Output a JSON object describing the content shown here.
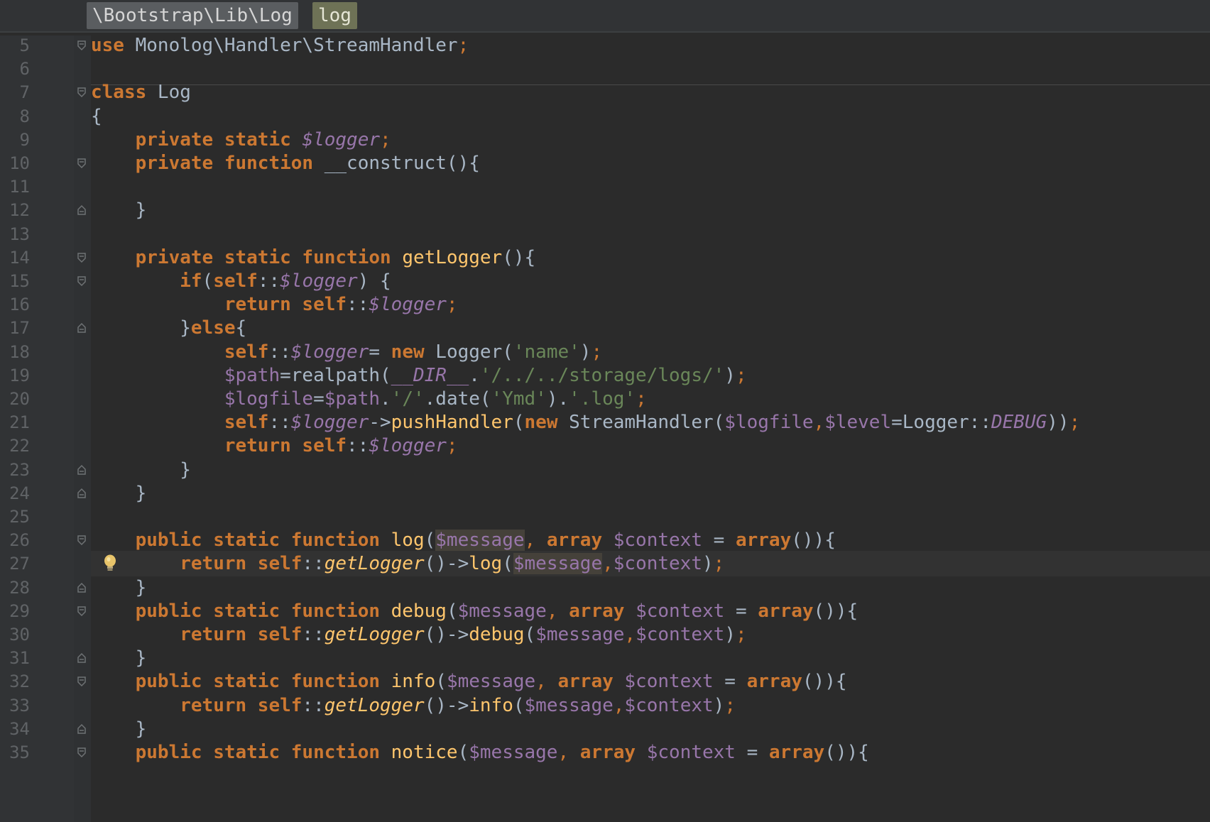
{
  "breadcrumb": {
    "namespace": "\\Bootstrap\\Lib\\Log",
    "class": "log"
  },
  "editor": {
    "current_line": 27,
    "lines": [
      {
        "n": 5,
        "fold": "open",
        "tokens": [
          [
            "kw",
            "use"
          ],
          [
            "plain",
            " Monolog\\Handler\\StreamHandler"
          ],
          [
            "pun",
            ";"
          ]
        ]
      },
      {
        "n": 6,
        "fold": "",
        "tokens": []
      },
      {
        "n": 7,
        "fold": "open",
        "tokens": [
          [
            "kw",
            "class"
          ],
          [
            "plain",
            " Log"
          ]
        ]
      },
      {
        "n": 8,
        "fold": "",
        "tokens": [
          [
            "plain",
            "{"
          ]
        ]
      },
      {
        "n": 9,
        "fold": "",
        "tokens": [
          [
            "plain",
            "    "
          ],
          [
            "kw",
            "private static "
          ],
          [
            "ivar",
            "$logger"
          ],
          [
            "pun",
            ";"
          ]
        ]
      },
      {
        "n": 10,
        "fold": "open",
        "tokens": [
          [
            "plain",
            "    "
          ],
          [
            "kw",
            "private function "
          ],
          [
            "plain",
            "__construct(){"
          ]
        ]
      },
      {
        "n": 11,
        "fold": "",
        "tokens": []
      },
      {
        "n": 12,
        "fold": "close",
        "tokens": [
          [
            "plain",
            "    }"
          ]
        ]
      },
      {
        "n": 13,
        "fold": "",
        "tokens": []
      },
      {
        "n": 14,
        "fold": "open",
        "tokens": [
          [
            "plain",
            "    "
          ],
          [
            "kw",
            "private static function "
          ],
          [
            "fn",
            "getLogger"
          ],
          [
            "plain",
            "(){"
          ]
        ]
      },
      {
        "n": 15,
        "fold": "open",
        "tokens": [
          [
            "plain",
            "        "
          ],
          [
            "kw",
            "if"
          ],
          [
            "plain",
            "("
          ],
          [
            "kw",
            "self"
          ],
          [
            "plain",
            "::"
          ],
          [
            "ivar",
            "$logger"
          ],
          [
            "plain",
            ") {"
          ]
        ]
      },
      {
        "n": 16,
        "fold": "",
        "tokens": [
          [
            "plain",
            "            "
          ],
          [
            "kw",
            "return self"
          ],
          [
            "plain",
            "::"
          ],
          [
            "ivar",
            "$logger"
          ],
          [
            "pun",
            ";"
          ]
        ]
      },
      {
        "n": 17,
        "fold": "close",
        "tokens": [
          [
            "plain",
            "        }"
          ],
          [
            "kw",
            "else"
          ],
          [
            "plain",
            "{"
          ]
        ]
      },
      {
        "n": 18,
        "fold": "",
        "tokens": [
          [
            "plain",
            "            "
          ],
          [
            "kw",
            "self"
          ],
          [
            "plain",
            "::"
          ],
          [
            "ivar",
            "$logger"
          ],
          [
            "plain",
            "= "
          ],
          [
            "kw",
            "new "
          ],
          [
            "plain",
            "Logger("
          ],
          [
            "str",
            "'name'"
          ],
          [
            "plain",
            ")"
          ],
          [
            "pun",
            ";"
          ]
        ]
      },
      {
        "n": 19,
        "fold": "",
        "tokens": [
          [
            "plain",
            "            "
          ],
          [
            "var",
            "$path"
          ],
          [
            "plain",
            "=realpath("
          ],
          [
            "ivar",
            "__DIR__"
          ],
          [
            "plain",
            "."
          ],
          [
            "str",
            "'/../../storage/logs/'"
          ],
          [
            "plain",
            ")"
          ],
          [
            "pun",
            ";"
          ]
        ]
      },
      {
        "n": 20,
        "fold": "",
        "tokens": [
          [
            "plain",
            "            "
          ],
          [
            "var",
            "$logfile"
          ],
          [
            "plain",
            "="
          ],
          [
            "var",
            "$path"
          ],
          [
            "plain",
            "."
          ],
          [
            "str",
            "'/'"
          ],
          [
            "plain",
            ".date("
          ],
          [
            "str",
            "'Ymd'"
          ],
          [
            "plain",
            ")."
          ],
          [
            "str",
            "'.log'"
          ],
          [
            "pun",
            ";"
          ]
        ]
      },
      {
        "n": 21,
        "fold": "",
        "tokens": [
          [
            "plain",
            "            "
          ],
          [
            "kw",
            "self"
          ],
          [
            "plain",
            "::"
          ],
          [
            "ivar",
            "$logger"
          ],
          [
            "plain",
            "->"
          ],
          [
            "fn",
            "pushHandler"
          ],
          [
            "plain",
            "("
          ],
          [
            "kw",
            "new "
          ],
          [
            "plain",
            "StreamHandler("
          ],
          [
            "var",
            "$logfile"
          ],
          [
            "pun",
            ","
          ],
          [
            "var",
            "$level"
          ],
          [
            "plain",
            "=Logger::"
          ],
          [
            "ivar",
            "DEBUG"
          ],
          [
            "plain",
            "))"
          ],
          [
            "pun",
            ";"
          ]
        ]
      },
      {
        "n": 22,
        "fold": "",
        "tokens": [
          [
            "plain",
            "            "
          ],
          [
            "kw",
            "return self"
          ],
          [
            "plain",
            "::"
          ],
          [
            "ivar",
            "$logger"
          ],
          [
            "pun",
            ";"
          ]
        ]
      },
      {
        "n": 23,
        "fold": "close",
        "tokens": [
          [
            "plain",
            "        }"
          ]
        ]
      },
      {
        "n": 24,
        "fold": "close",
        "tokens": [
          [
            "plain",
            "    }"
          ]
        ]
      },
      {
        "n": 25,
        "fold": "",
        "tokens": []
      },
      {
        "n": 26,
        "fold": "open",
        "tokens": [
          [
            "plain",
            "    "
          ],
          [
            "kw",
            "public static function "
          ],
          [
            "fn",
            "log"
          ],
          [
            "plain",
            "("
          ],
          [
            "hl",
            "$message"
          ],
          [
            "pun",
            ", "
          ],
          [
            "kw",
            "array "
          ],
          [
            "var",
            "$context"
          ],
          [
            "plain",
            " = "
          ],
          [
            "kw",
            "array"
          ],
          [
            "plain",
            "()){"
          ]
        ]
      },
      {
        "n": 27,
        "fold": "",
        "bulb": true,
        "tokens": [
          [
            "plain",
            "        "
          ],
          [
            "kw",
            "return self"
          ],
          [
            "plain",
            "::"
          ],
          [
            "ifn",
            "getLogger"
          ],
          [
            "plain",
            "()->"
          ],
          [
            "fn",
            "log"
          ],
          [
            "plain",
            "("
          ],
          [
            "hl",
            "$message"
          ],
          [
            "pun",
            ","
          ],
          [
            "var",
            "$context"
          ],
          [
            "plain",
            ")"
          ],
          [
            "pun",
            ";"
          ]
        ]
      },
      {
        "n": 28,
        "fold": "close",
        "tokens": [
          [
            "plain",
            "    }"
          ]
        ]
      },
      {
        "n": 29,
        "fold": "open",
        "tokens": [
          [
            "plain",
            "    "
          ],
          [
            "kw",
            "public static function "
          ],
          [
            "fn",
            "debug"
          ],
          [
            "plain",
            "("
          ],
          [
            "var",
            "$message"
          ],
          [
            "pun",
            ", "
          ],
          [
            "kw",
            "array "
          ],
          [
            "var",
            "$context"
          ],
          [
            "plain",
            " = "
          ],
          [
            "kw",
            "array"
          ],
          [
            "plain",
            "()){"
          ]
        ]
      },
      {
        "n": 30,
        "fold": "",
        "tokens": [
          [
            "plain",
            "        "
          ],
          [
            "kw",
            "return self"
          ],
          [
            "plain",
            "::"
          ],
          [
            "ifn",
            "getLogger"
          ],
          [
            "plain",
            "()->"
          ],
          [
            "fn",
            "debug"
          ],
          [
            "plain",
            "("
          ],
          [
            "var",
            "$message"
          ],
          [
            "pun",
            ","
          ],
          [
            "var",
            "$context"
          ],
          [
            "plain",
            ")"
          ],
          [
            "pun",
            ";"
          ]
        ]
      },
      {
        "n": 31,
        "fold": "close",
        "tokens": [
          [
            "plain",
            "    }"
          ]
        ]
      },
      {
        "n": 32,
        "fold": "open",
        "tokens": [
          [
            "plain",
            "    "
          ],
          [
            "kw",
            "public static function "
          ],
          [
            "fn",
            "info"
          ],
          [
            "plain",
            "("
          ],
          [
            "var",
            "$message"
          ],
          [
            "pun",
            ", "
          ],
          [
            "kw",
            "array "
          ],
          [
            "var",
            "$context"
          ],
          [
            "plain",
            " = "
          ],
          [
            "kw",
            "array"
          ],
          [
            "plain",
            "()){"
          ]
        ]
      },
      {
        "n": 33,
        "fold": "",
        "tokens": [
          [
            "plain",
            "        "
          ],
          [
            "kw",
            "return self"
          ],
          [
            "plain",
            "::"
          ],
          [
            "ifn",
            "getLogger"
          ],
          [
            "plain",
            "()->"
          ],
          [
            "fn",
            "info"
          ],
          [
            "plain",
            "("
          ],
          [
            "var",
            "$message"
          ],
          [
            "pun",
            ","
          ],
          [
            "var",
            "$context"
          ],
          [
            "plain",
            ")"
          ],
          [
            "pun",
            ";"
          ]
        ]
      },
      {
        "n": 34,
        "fold": "close",
        "tokens": [
          [
            "plain",
            "    }"
          ]
        ]
      },
      {
        "n": 35,
        "fold": "open",
        "tokens": [
          [
            "plain",
            "    "
          ],
          [
            "kw",
            "public static function "
          ],
          [
            "fn",
            "notice"
          ],
          [
            "plain",
            "("
          ],
          [
            "var",
            "$message"
          ],
          [
            "pun",
            ", "
          ],
          [
            "kw",
            "array "
          ],
          [
            "var",
            "$context"
          ],
          [
            "plain",
            " = "
          ],
          [
            "kw",
            "array"
          ],
          [
            "plain",
            "()){"
          ]
        ]
      }
    ]
  }
}
